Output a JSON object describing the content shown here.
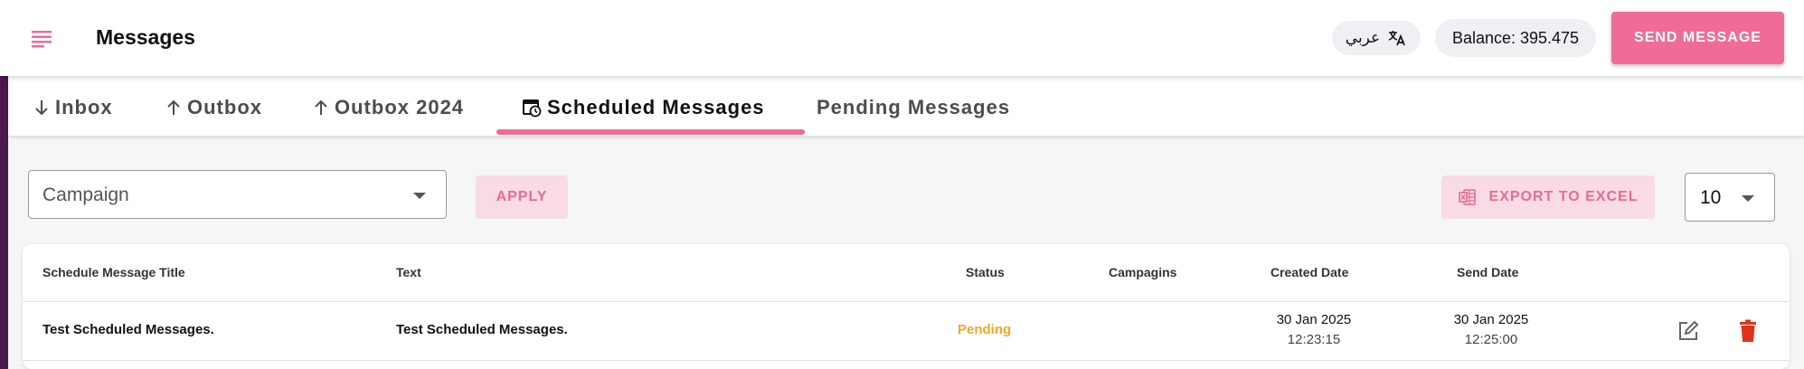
{
  "header": {
    "title": "Messages",
    "menu_icon": "menu-lines-icon",
    "lang_label": "عربي",
    "lang_icon": "translate-icon",
    "balance_label": "Balance: 395.475",
    "send_label": "SEND MESSAGE"
  },
  "tabs": [
    {
      "label": "Inbox",
      "icon": "arrow-down-icon"
    },
    {
      "label": "Outbox",
      "icon": "arrow-up-icon"
    },
    {
      "label": "Outbox 2024",
      "icon": "arrow-up-icon"
    },
    {
      "label": "Scheduled Messages",
      "icon": "scheduled-calendar-icon",
      "active": true
    },
    {
      "label": "Pending Messages"
    }
  ],
  "filters": {
    "campaign_placeholder": "Campaign",
    "apply_label": "APPLY",
    "export_label": "EXPORT TO EXCEL",
    "export_icon": "excel-icon",
    "page_size": "10"
  },
  "table": {
    "columns": [
      "Schedule Message Title",
      "Text",
      "Status",
      "Campagins",
      "Created Date",
      "Send Date"
    ],
    "rows": [
      {
        "title": "Test Scheduled Messages.",
        "text": "Test Scheduled Messages.",
        "status": "Pending",
        "campaigns": "",
        "created_date": "30 Jan 2025",
        "created_time": "12:23:15",
        "send_date": "30 Jan 2025",
        "send_time": "12:25:00"
      }
    ]
  },
  "colors": {
    "accent": "#f06b96",
    "accent_light": "#f9dbe5",
    "status_pending": "#f5a623",
    "delete": "#e0341c",
    "sidebar": "#4a1a4f"
  }
}
